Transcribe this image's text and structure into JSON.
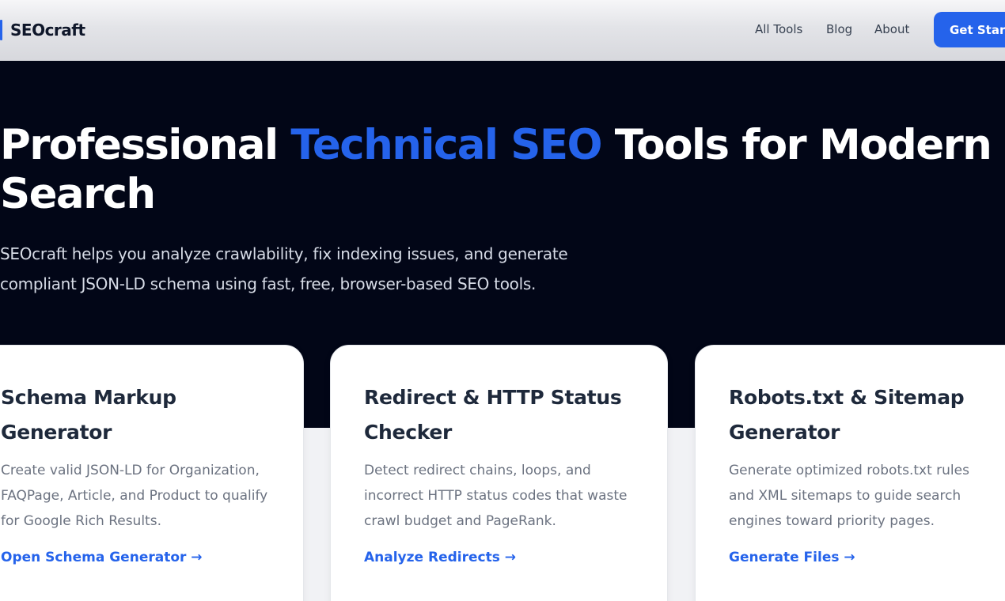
{
  "header": {
    "logo_text": "SEOcraft",
    "nav": [
      "All Tools",
      "Blog",
      "About"
    ],
    "cta_label": "Get Started"
  },
  "hero": {
    "title_part1": "Professional ",
    "title_accent": "Technical SEO",
    "title_part2": " Tools for Modern Search",
    "subtitle": "SEOcraft helps you analyze crawlability, fix indexing issues, and generate compliant JSON-LD schema using fast, free, browser-based SEO tools."
  },
  "cards": [
    {
      "title": "Schema Markup Generator",
      "description": "Create valid JSON-LD for Organization, FAQPage, Article, and Product to qualify for Google Rich Results.",
      "link": "Open Schema Generator →"
    },
    {
      "title": "Redirect & HTTP Status Checker",
      "description": "Detect redirect chains, loops, and incorrect HTTP status codes that waste crawl budget and PageRank.",
      "link": "Analyze Redirects →"
    },
    {
      "title": "Robots.txt & Sitemap Generator",
      "description": "Generate optimized robots.txt rules and XML sitemaps to guide search engines toward priority pages.",
      "link": "Generate Files →"
    }
  ],
  "colors": {
    "accent": "#2563eb",
    "hero_bg": "#020617",
    "heading": "#1e293b",
    "muted": "#6b7280"
  }
}
